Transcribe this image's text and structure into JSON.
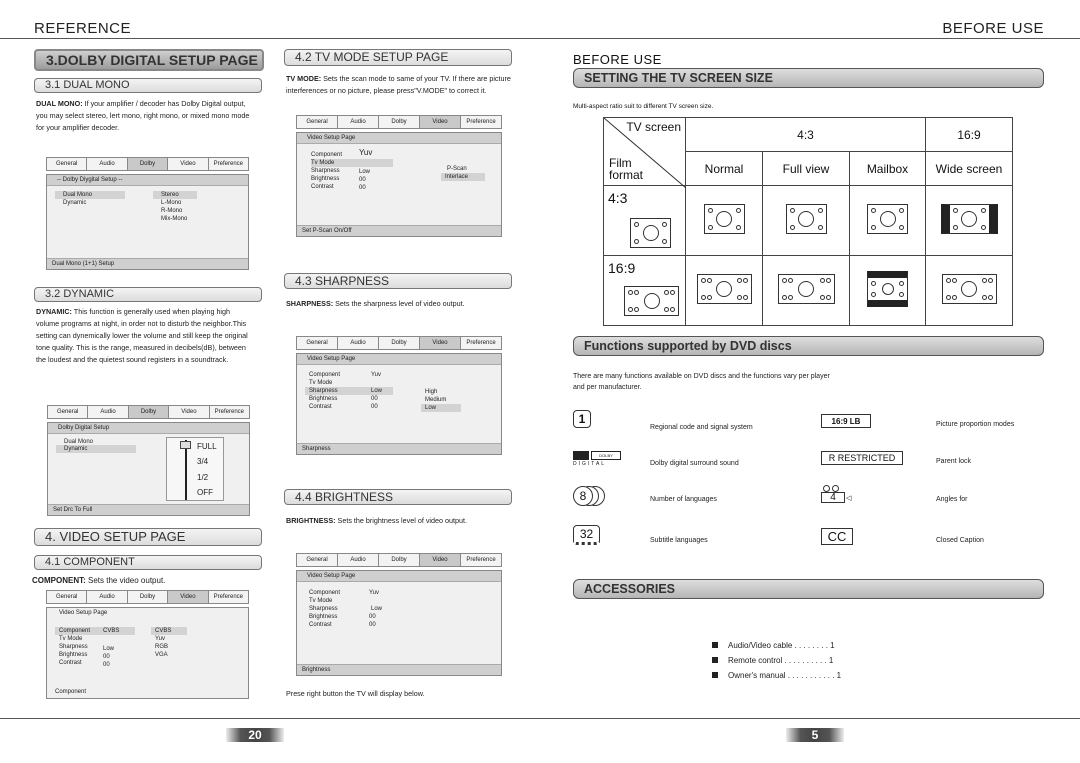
{
  "left_header": "REFERENCE",
  "right_header": "BEFORE USE",
  "page_numbers": {
    "left": "20",
    "right": "5"
  },
  "col1": {
    "sec3_title": "3.DOLBY DIGITAL SETUP PAGE",
    "sec31_title": "3.1 DUAL MONO",
    "sec31_lead": "DUAL MONO:",
    "sec31_text": " If your amplifier / decoder has Dolby Digital output, you may select stereo, lert mono, right mono, or mixed mono mode for your amplifier decoder.",
    "osd1": {
      "tabs": [
        "General",
        "Audio",
        "Dolby",
        "Video",
        "Preference"
      ],
      "title": "-- Dolby Diygital Setup --",
      "items": [
        "Dual Mono",
        "Dynamic"
      ],
      "options": [
        "Stereo",
        "L-Mono",
        "R-Mono",
        "Mix-Mono"
      ],
      "footer": "Dual Mono (1+1) Setup"
    },
    "sec32_title": "3.2 DYNAMIC",
    "sec32_lead": "DYNAMIC:",
    "sec32_text": " This function is generally used when playing high volume programs at night, in order not to disturb the neighbor.This setting can dynemically lower the volume and still keep the original tone quality. This is the range, measured in decibels(dB), between the loudest and the quietest sound registers in a soundtrack.",
    "osd2": {
      "tabs": [
        "General",
        "Audio",
        "Dolby",
        "Video",
        "Preference"
      ],
      "title": "Dolby Digital Setup",
      "items": [
        "Dual Mono",
        "Dynamic"
      ],
      "levels": [
        "FULL",
        "3/4",
        "1/2",
        "OFF"
      ],
      "footer": "Set Drc To Full"
    },
    "sec4_title": "4. VIDEO SETUP PAGE",
    "sec41_title": "4.1 COMPONENT",
    "sec41_lead": "COMPONENT:",
    "sec41_text": " Sets the video output.",
    "osd3": {
      "tabs": [
        "General",
        "Audio",
        "Dolby",
        "Video",
        "Preference"
      ],
      "title": "Video Setup Page",
      "items": [
        "Component",
        "Tv Mode",
        "Sharpness",
        "Brightness",
        "Contrast"
      ],
      "values": [
        "CVBS",
        "",
        "Low",
        "00",
        "00"
      ],
      "options": [
        "CVBS",
        "Yuv",
        "RGB",
        "VGA"
      ],
      "footer": "Component"
    }
  },
  "col2": {
    "sec42_title": "4.2 TV MODE  SETUP PAGE",
    "sec42_lead": "TV MODE:",
    "sec42_text": " Sets the scan mode to same of your TV. If there are picture interferences or no picture, please press\"V.MODE\" to correct it.",
    "osd4": {
      "tabs": [
        "General",
        "Audio",
        "Dolby",
        "Video",
        "Preference"
      ],
      "title": "Video Setup Page",
      "items": [
        "Component",
        "Tv Mode",
        "Sharpness",
        "Brightness",
        "Contrast"
      ],
      "values": [
        "Yuv",
        "",
        "Low",
        "00",
        "00"
      ],
      "options": [
        "P-Scan",
        "Interlace"
      ],
      "footer": "Set P-Scan On/Off"
    },
    "sec43_title": "4.3 SHARPNESS",
    "sec43_lead": "SHARPNESS:",
    "sec43_text": " Sets the sharpness level of video output.",
    "osd5": {
      "tabs": [
        "General",
        "Audio",
        "Dolby",
        "Video",
        "Preference"
      ],
      "title": "Video Setup Page",
      "items": [
        "Component",
        "Tv Mode",
        "Sharpness",
        "Brightness",
        "Contrast"
      ],
      "values": [
        "Yuv",
        "",
        "Low",
        "00",
        "00"
      ],
      "options": [
        "High",
        "Medium",
        "Low"
      ],
      "footer": "Sharpness"
    },
    "sec44_title": "4.4 BRIGHTNESS",
    "sec44_lead": "BRIGHTNESS:",
    "sec44_text": " Sets the brightness level of video output.",
    "osd6": {
      "tabs": [
        "General",
        "Audio",
        "Dolby",
        "Video",
        "Preference"
      ],
      "title": "Video Setup Page",
      "items": [
        "Component",
        "Tv Mode",
        "Sharpness",
        "Brightness",
        "Contrast"
      ],
      "values": [
        "Yuv",
        "",
        "Low",
        "00",
        "00"
      ],
      "footer": "Brightness"
    },
    "closing": "Prese right button the TV will display below."
  },
  "right": {
    "subheader": "BEFORE USE",
    "screen_title": "SETTING THE TV SCREEN SIZE",
    "screen_intro": "Multi-aspect ratio suit to different TV screen size.",
    "table": {
      "corner_top": "TV screen",
      "corner_bottom": "Film format",
      "group1": "4:3",
      "group2": "16:9",
      "cols": [
        "Normal",
        "Full view",
        "Mailbox",
        "Wide screen"
      ],
      "rows": [
        "4:3",
        "16:9"
      ]
    },
    "functions_title": "Functions supported by DVD discs",
    "functions_intro": "There are many functions available on DVD discs and the functions vary per player and per manufacturer.",
    "features": [
      {
        "icon": "1",
        "label": "Regional code and signal system"
      },
      {
        "icon": "DOLBY DIGITAL",
        "label": "Dolby digital surround sound"
      },
      {
        "icon": "8",
        "label": "Number of languages"
      },
      {
        "icon": "32",
        "label": "Subtitle languages"
      },
      {
        "icon": "16:9 LB",
        "label": "Picture proportion modes"
      },
      {
        "icon": "R RESTRICTED",
        "label": "Parent lock"
      },
      {
        "icon": "4",
        "label": "Angles for"
      },
      {
        "icon": "CC",
        "label": "Closed Caption"
      }
    ],
    "accessories_title": "ACCESSORIES",
    "accessories": [
      "Audio/Video  cable . . . . . . . . 1",
      "Remote control  . . . . . . . . . . 1",
      "Owner's manual . . . . . . . . . . . 1"
    ]
  }
}
